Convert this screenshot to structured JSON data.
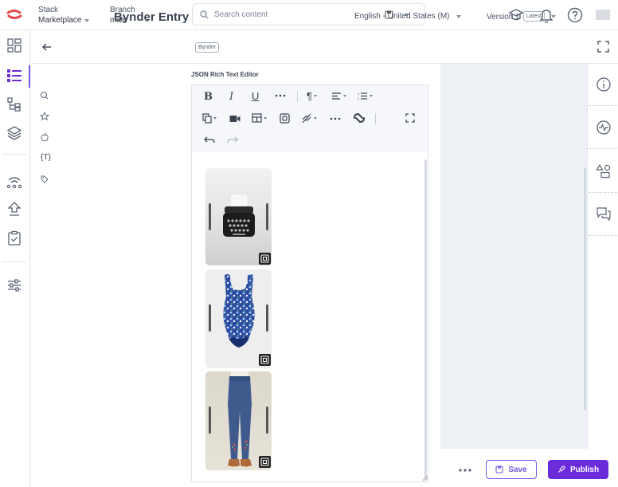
{
  "topbar": {
    "stack_label": "Stack",
    "stack_value": "Marketplace",
    "branch_label": "Branch",
    "branch_value": "main",
    "search_placeholder": "Search content"
  },
  "entry": {
    "title": "Bynder Entry",
    "badge": "Bynder",
    "locale": "English - United States (M)",
    "version": "Version 1",
    "version_badge": "Latest"
  },
  "field": {
    "label": "JSON Rich Text Editor"
  },
  "assets": [
    {
      "name": "typewriter"
    },
    {
      "name": "floral swimsuit"
    },
    {
      "name": "embroidered jeans"
    }
  ],
  "actions": {
    "save": "Save",
    "publish": "Publish"
  },
  "colors": {
    "accent": "#6c5ce7",
    "publish": "#6c2bd9"
  }
}
